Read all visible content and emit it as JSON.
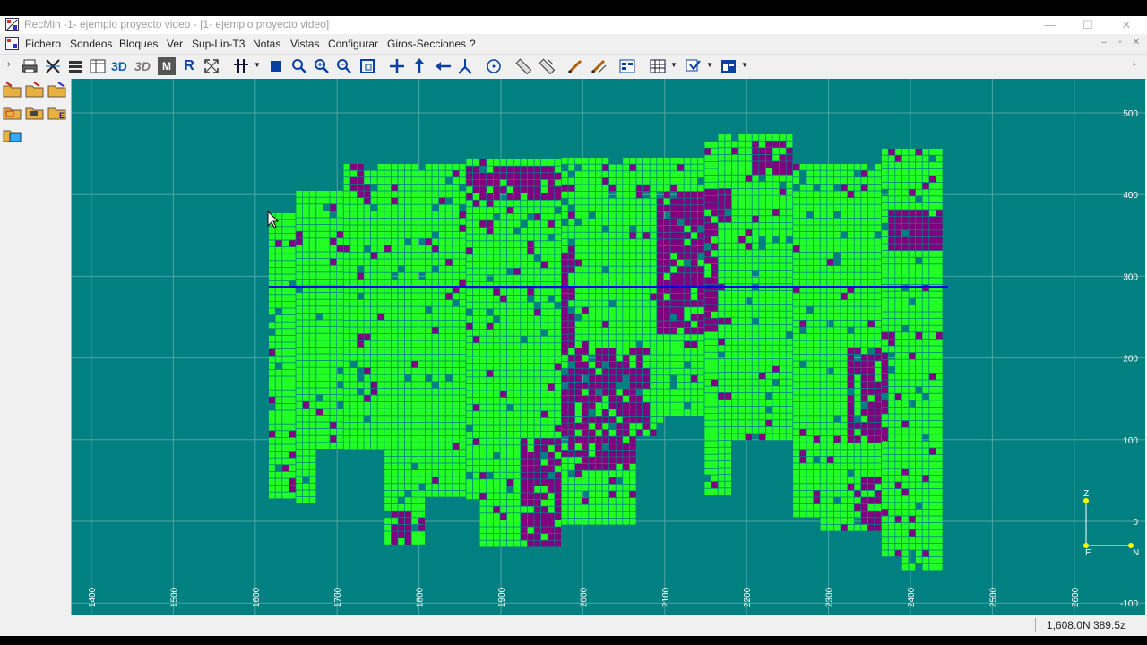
{
  "titlebar": {
    "title": "RecMin -1- ejemplo proyecto video - [1- ejemplo proyecto video]",
    "minimize": "—",
    "maximize": "☐",
    "close": "✕"
  },
  "menu": {
    "items": [
      "Fichero",
      "Sondeos",
      "Bloques",
      "Ver",
      "Sup-Lin-T3",
      "Notas",
      "Vistas",
      "Configurar",
      "Giros-Secciones",
      "?"
    ],
    "mdi_minimize": "–",
    "mdi_restore": "▫",
    "mdi_close": "✕"
  },
  "toolbar": {
    "labels": [
      "3D",
      "3D",
      "M",
      "R"
    ]
  },
  "plot": {
    "background": "#008080",
    "ore_color": "#800080",
    "waste_color": "#22ff22",
    "y_ticks": [
      "500",
      "400",
      "300",
      "200",
      "100",
      "0",
      "-100"
    ],
    "x_ticks": [
      "1400",
      "1500",
      "1600",
      "1700",
      "1800",
      "1900",
      "2000",
      "2100",
      "2200",
      "2300",
      "2400",
      "2500",
      "2600"
    ],
    "axis_labels": {
      "z": "Z",
      "e": "E",
      "n": "N"
    }
  },
  "status": {
    "coords": "1,608.0N 389.5z"
  }
}
